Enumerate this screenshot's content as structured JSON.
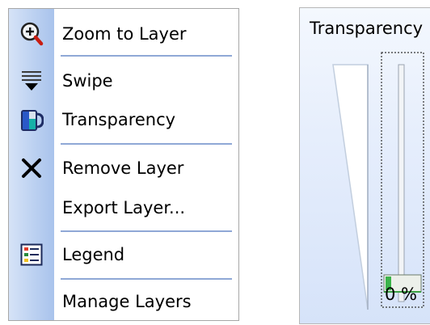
{
  "menu": {
    "items": [
      {
        "label": "Zoom to Layer",
        "icon": "zoom-magnifier-icon"
      },
      {
        "label": "Swipe",
        "icon": "swipe-icon"
      },
      {
        "label": "Transparency",
        "icon": "transparency-icon"
      },
      {
        "label": "Remove Layer",
        "icon": "remove-x-icon"
      },
      {
        "label": "Export Layer...",
        "icon": null
      },
      {
        "label": "Legend",
        "icon": "legend-icon"
      },
      {
        "label": "Manage Layers",
        "icon": null
      }
    ]
  },
  "transparency_panel": {
    "title": "Transparency",
    "value_label": "0 %",
    "value": 0
  },
  "colors": {
    "menu_strip": "#bcd1f1",
    "separator": "#8fa8d6",
    "panel_bg": "#e6eefc",
    "slider_thumb": "#3bb34a"
  }
}
